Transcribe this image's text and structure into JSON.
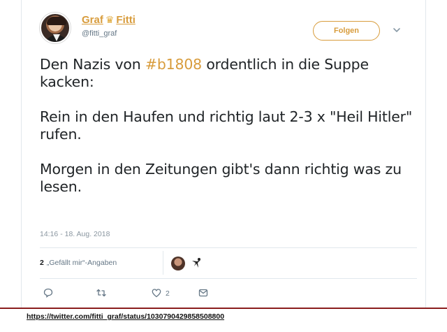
{
  "tweet": {
    "display_name_part1": "Graf",
    "display_name_part2": "Fitti",
    "handle": "@fitti_graf",
    "follow_label": "Folgen",
    "line1_before": "Den Nazis von ",
    "hashtag": "#b1808",
    "line1_after": " ordentlich in die Suppe kacken:",
    "paragraph2": "Rein in den Haufen und richtig laut 2-3 x \"Heil Hitler\" rufen.",
    "paragraph3": "Morgen in den Zeitungen gibt's dann richtig was zu lesen.",
    "timestamp": "14:16 - 18. Aug. 2018",
    "likes_count": "2",
    "likes_label": "„Gefällt mir“-Angaben",
    "like_action_count": "2"
  },
  "footer": {
    "url": "https://twitter.com/fitti_graf/status/1030790429858508800"
  },
  "colors": {
    "accent": "#d89c3c",
    "secondary_text": "#657786",
    "footer_line": "#8a1d1d"
  },
  "icons": {
    "name_badge": "crown-icon",
    "menu": "chevron-down-icon",
    "reply": "speech-bubble-icon",
    "retweet": "retweet-icon",
    "like": "heart-icon",
    "direct_message": "envelope-icon"
  }
}
